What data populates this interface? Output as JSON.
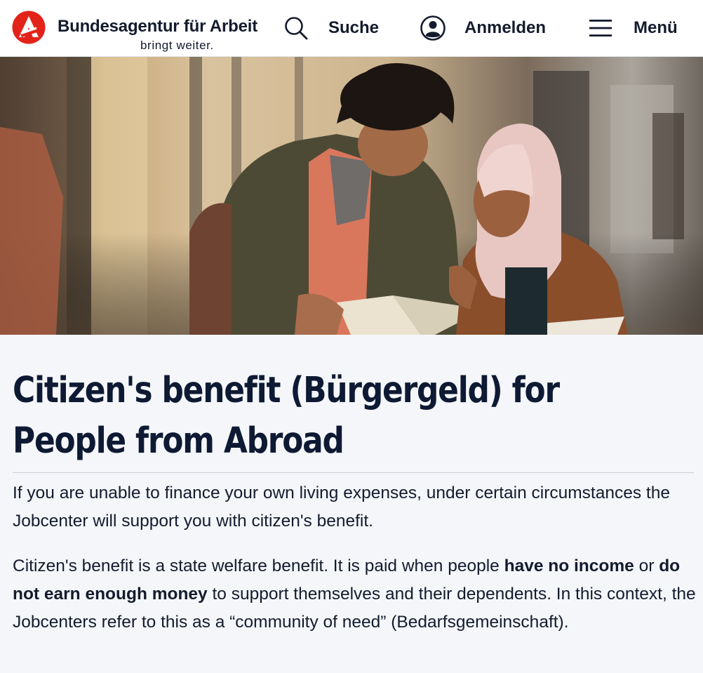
{
  "header": {
    "brand_name": "Bundesagentur für Arbeit",
    "brand_tagline": "bringt weiter.",
    "logo_icon": "ba-logo-icon",
    "nav": {
      "search": {
        "label": "Suche",
        "icon": "search-icon"
      },
      "login": {
        "label": "Anmelden",
        "icon": "user-circle-icon"
      },
      "menu": {
        "label": "Menü",
        "icon": "hamburger-menu-icon"
      }
    }
  },
  "hero": {
    "image": "photo of a young man and a woman in a headscarf reading a book together in a street"
  },
  "main": {
    "title": "Citizen's benefit (Bürgergeld) for People from Abroad",
    "intro": "If you are unable to finance your own living expenses, under certain circumstances the Jobcenter will support you with citizen's benefit.",
    "body": {
      "part1": "Citizen's benefit is a state welfare benefit. It is paid when people ",
      "bold1": "have no income",
      "part2": " or ",
      "bold2": "do not earn enough money",
      "part3": " to support themselves and their dependents. In this context, the Jobcenters refer to this as a “community of need” (Bedarfsgemeinschaft)."
    }
  },
  "colors": {
    "brand_red": "#e2231a",
    "text_dark": "#0e1a33",
    "page_bg": "#f4f6f9"
  }
}
